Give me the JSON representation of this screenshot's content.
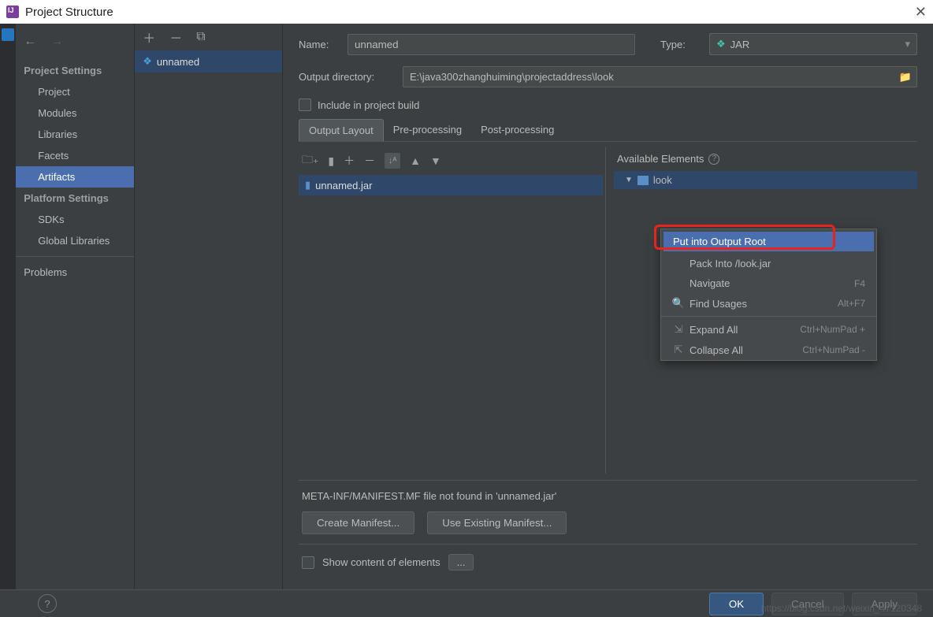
{
  "titlebar": {
    "title": "Project Structure"
  },
  "sidebar": {
    "section1": "Project Settings",
    "items1": [
      "Project",
      "Modules",
      "Libraries",
      "Facets",
      "Artifacts"
    ],
    "section2": "Platform Settings",
    "items2": [
      "SDKs",
      "Global Libraries"
    ],
    "problems": "Problems"
  },
  "artifactList": {
    "entry": "unnamed"
  },
  "form": {
    "nameLabel": "Name:",
    "nameValue": "unnamed",
    "typeLabel": "Type:",
    "typeValue": "JAR",
    "dirLabel": "Output directory:",
    "dirValue": "E:\\java300zhanghuiming\\projectaddress\\look",
    "includeLabel": "Include in project build"
  },
  "tabs": [
    "Output Layout",
    "Pre-processing",
    "Post-processing"
  ],
  "layoutTree": {
    "root": "unnamed.jar"
  },
  "available": {
    "header": "Available Elements",
    "module": "look"
  },
  "contextMenu": {
    "highlighted": "Put into Output Root",
    "items": [
      {
        "label": "Pack Into /look.jar",
        "shortcut": "",
        "icon": ""
      },
      {
        "label": "Navigate",
        "shortcut": "F4",
        "icon": ""
      },
      {
        "label": "Find Usages",
        "shortcut": "Alt+F7",
        "icon": "search"
      },
      {
        "label": "sep"
      },
      {
        "label": "Expand All",
        "shortcut": "Ctrl+NumPad +",
        "icon": "expand"
      },
      {
        "label": "Collapse All",
        "shortcut": "Ctrl+NumPad -",
        "icon": "collapse"
      }
    ]
  },
  "manifest": {
    "msg": "META-INF/MANIFEST.MF file not found in 'unnamed.jar'",
    "createBtn": "Create Manifest...",
    "useBtn": "Use Existing Manifest..."
  },
  "showContent": "Show content of elements",
  "footer": {
    "ok": "OK",
    "cancel": "Cancel",
    "apply": "Apply"
  },
  "watermark": "https://blog.csdn.net/weixin_47120348"
}
